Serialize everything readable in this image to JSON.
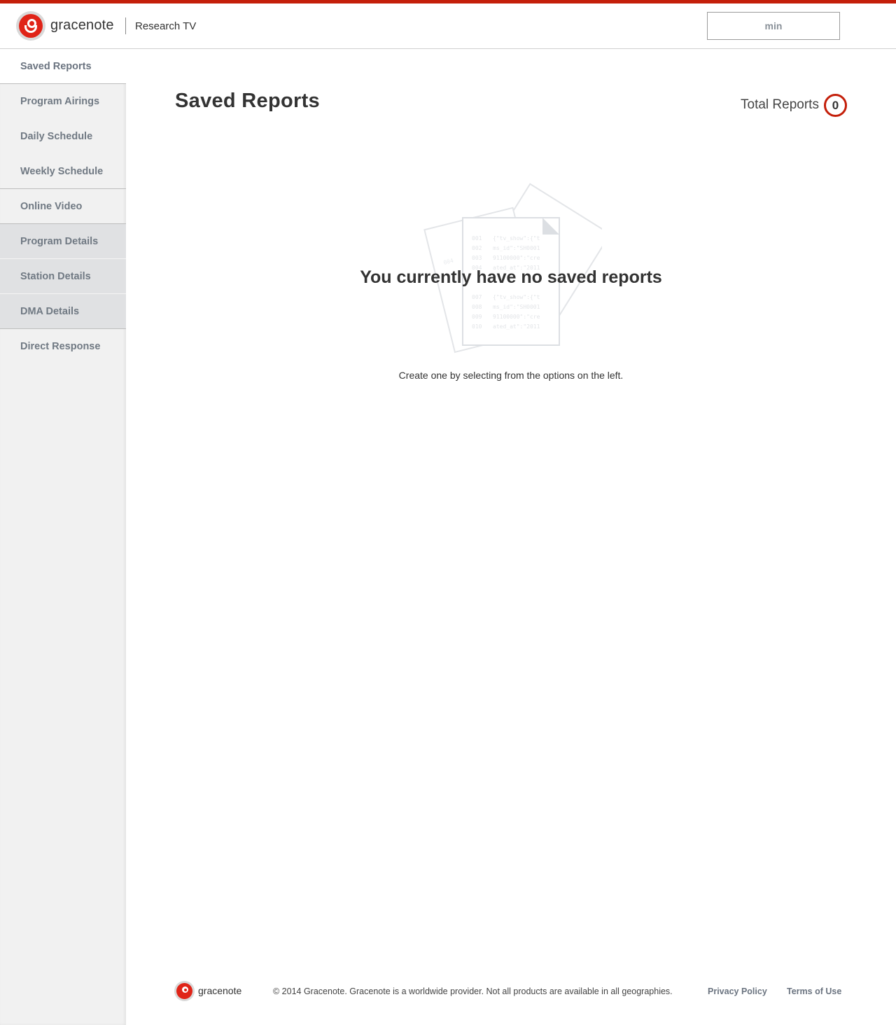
{
  "header": {
    "brand": "gracenote",
    "product": "Research TV",
    "user_button": "min"
  },
  "sidebar": {
    "items": [
      {
        "label": "Saved Reports",
        "active": true
      },
      {
        "label": "Program Airings"
      },
      {
        "label": "Daily Schedule"
      },
      {
        "label": "Weekly Schedule"
      },
      {
        "label": "Online Video"
      },
      {
        "label": "Program Details"
      },
      {
        "label": "Station Details"
      },
      {
        "label": "DMA Details"
      },
      {
        "label": "Direct Response"
      }
    ]
  },
  "main": {
    "title": "Saved Reports",
    "total_label": "Total Reports",
    "total_count": "0",
    "empty_title": "You currently have no saved reports",
    "empty_subtitle": "Create one by selecting from the options on the left."
  },
  "illustration": {
    "lines": [
      {
        "num": "001",
        "text": "{\"tv_show\":{\"t"
      },
      {
        "num": "002",
        "text": "ms_id\":\"SH0001"
      },
      {
        "num": "003",
        "text": "91100000\":\"cre"
      },
      {
        "num": "004",
        "text": "ated_at\":\"2011"
      },
      {
        "num": "007",
        "text": "{\"tv_show\":{\"t"
      },
      {
        "num": "008",
        "text": "ms_id\":\"SH0001"
      },
      {
        "num": "009",
        "text": "91100000\":\"cre"
      },
      {
        "num": "010",
        "text": "ated_at\":\"2011"
      }
    ]
  },
  "footer": {
    "brand": "gracenote",
    "copyright": "© 2014 Gracenote. Gracenote is a worldwide provider. Not all products are available in all geographies.",
    "privacy": "Privacy Policy",
    "terms": "Terms of Use"
  },
  "colors": {
    "accent": "#c41f0a",
    "logo_red": "#e02418",
    "nav_text": "#707983"
  }
}
